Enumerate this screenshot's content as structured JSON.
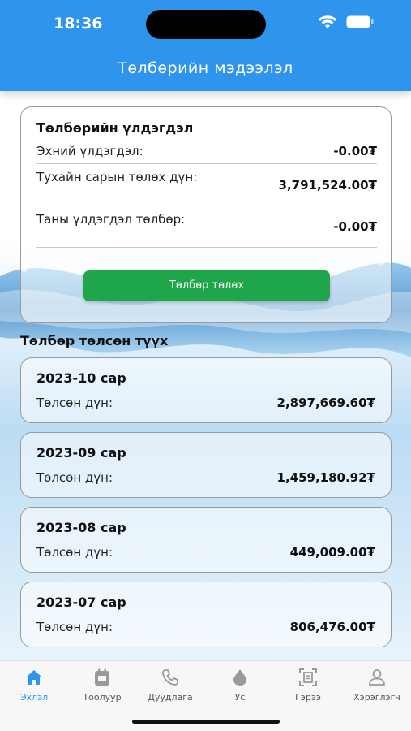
{
  "status_bar": {
    "time": "18:36"
  },
  "header": {
    "title": "Төлбөрийн мэдээлэл"
  },
  "balance": {
    "title": "Төлбөрийн үлдэгдэл",
    "rows": [
      {
        "label": "Эхний үлдэгдэл:",
        "value": "-0.00₮"
      },
      {
        "label": "Тухайн сарын төлөх дүн:",
        "value": "3,791,524.00₮"
      },
      {
        "label": "Таны үлдэгдэл төлбөр:",
        "value": "-0.00₮"
      }
    ],
    "pay_button": "Төлбөр төлөх"
  },
  "history": {
    "title": "Төлбөр төлсөн түүх",
    "items": [
      {
        "month": "2023-10 сар",
        "label": "Төлсөн дүн:",
        "amount": "2,897,669.60₮"
      },
      {
        "month": "2023-09 сар",
        "label": "Төлсөн дүн:",
        "amount": "1,459,180.92₮"
      },
      {
        "month": "2023-08 сар",
        "label": "Төлсөн дүн:",
        "amount": "449,009.00₮"
      },
      {
        "month": "2023-07 сар",
        "label": "Төлсөн дүн:",
        "amount": "806,476.00₮"
      }
    ]
  },
  "tabbar": {
    "items": [
      {
        "label": "Эхлэл",
        "icon": "home-icon",
        "active": true
      },
      {
        "label": "Тоолуур",
        "icon": "meter-icon",
        "active": false
      },
      {
        "label": "Дуудлага",
        "icon": "phone-icon",
        "active": false
      },
      {
        "label": "Ус",
        "icon": "water-drop-icon",
        "active": false
      },
      {
        "label": "Гэрээ",
        "icon": "contract-scan-icon",
        "active": false
      },
      {
        "label": "Хэрэглэгч",
        "icon": "user-icon",
        "active": false
      }
    ]
  },
  "colors": {
    "accent": "#2f95ec",
    "pay_button": "#1fa64a",
    "tab_inactive": "#555555"
  }
}
